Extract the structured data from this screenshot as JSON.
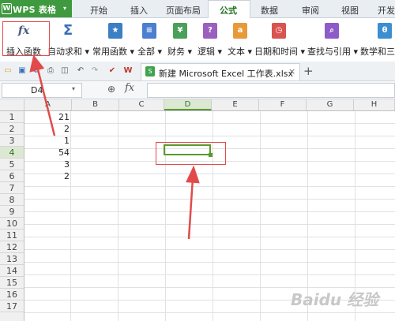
{
  "app": {
    "name": "WPS 表格"
  },
  "menu": {
    "tabs": [
      "开始",
      "插入",
      "页面布局",
      "公式",
      "数据",
      "审阅",
      "视图",
      "开发"
    ],
    "active_tab": "公式"
  },
  "ribbon": {
    "buttons": [
      {
        "label": "插入函数",
        "icon": "fx"
      },
      {
        "label": "自动求和 ▾",
        "icon": "Σ"
      },
      {
        "label": "常用函数 ▾",
        "icon": "★"
      },
      {
        "label": "全部 ▾",
        "icon": "≡"
      },
      {
        "label": "财务 ▾",
        "icon": "¥"
      },
      {
        "label": "逻辑 ▾",
        "icon": "?"
      },
      {
        "label": "文本 ▾",
        "icon": "a"
      },
      {
        "label": "日期和时间 ▾",
        "icon": "◷"
      },
      {
        "label": "查找与引用 ▾",
        "icon": "⌕"
      },
      {
        "label": "数学和三角",
        "icon": "θ"
      }
    ]
  },
  "doc_tab": {
    "title": "新建 Microsoft Excel 工作表.xlsx",
    "close": "×",
    "new": "+"
  },
  "formula_bar": {
    "name_box": "D4",
    "fx": "fx",
    "value": ""
  },
  "grid": {
    "columns": [
      "A",
      "B",
      "C",
      "D",
      "E",
      "F",
      "G",
      "H"
    ],
    "rows": [
      "1",
      "2",
      "3",
      "4",
      "5",
      "6",
      "7",
      "8",
      "9",
      "10",
      "11",
      "12",
      "13",
      "14",
      "15",
      "16",
      "17"
    ],
    "column_a_values": [
      "21",
      "2",
      "1",
      "54",
      "3",
      "2"
    ],
    "selected_cell": "D4"
  },
  "watermark": {
    "text": "Baidu 经验"
  },
  "colors": {
    "accent_green": "#3f9a3f",
    "selection_green": "#5a9a2c",
    "annotation_red": "#e24a4a"
  }
}
